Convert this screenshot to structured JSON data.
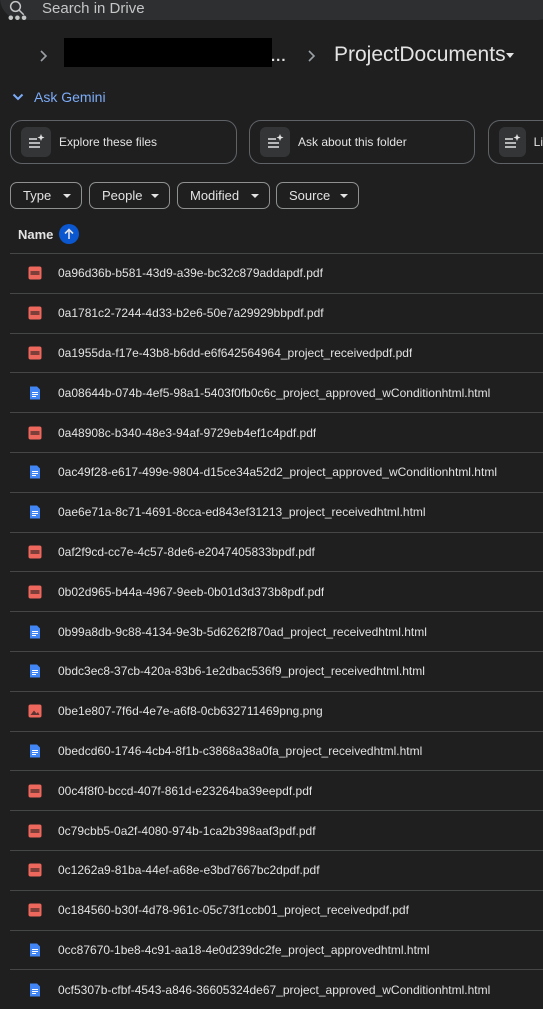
{
  "search": {
    "placeholder": "Search in Drive"
  },
  "breadcrumb": {
    "more": "•••",
    "ellipsis": "...",
    "current": "ProjectDocuments"
  },
  "gemini": {
    "label": "Ask Gemini"
  },
  "suggestions": [
    {
      "label": "Explore these files"
    },
    {
      "label": "Ask about this folder"
    },
    {
      "label": "Li"
    }
  ],
  "filters": [
    "Type",
    "People",
    "Modified",
    "Source"
  ],
  "table": {
    "name_header": "Name"
  },
  "files": [
    {
      "name": "0a96d36b-b581-43d9-a39e-bc32c879addapdf.pdf",
      "kind": "pdf"
    },
    {
      "name": "0a1781c2-7244-4d33-b2e6-50e7a29929bbpdf.pdf",
      "kind": "pdf"
    },
    {
      "name": "0a1955da-f17e-43b8-b6dd-e6f642564964_project_receivedpdf.pdf",
      "kind": "pdf"
    },
    {
      "name": "0a08644b-074b-4ef5-98a1-5403f0fb0c6c_project_approved_wConditionhtml.html",
      "kind": "doc"
    },
    {
      "name": "0a48908c-b340-48e3-94af-9729eb4ef1c4pdf.pdf",
      "kind": "pdf"
    },
    {
      "name": "0ac49f28-e617-499e-9804-d15ce34a52d2_project_approved_wConditionhtml.html",
      "kind": "doc"
    },
    {
      "name": "0ae6e71a-8c71-4691-8cca-ed843ef31213_project_receivedhtml.html",
      "kind": "doc"
    },
    {
      "name": "0af2f9cd-cc7e-4c57-8de6-e2047405833bpdf.pdf",
      "kind": "pdf"
    },
    {
      "name": "0b02d965-b44a-4967-9eeb-0b01d3d373b8pdf.pdf",
      "kind": "pdf"
    },
    {
      "name": "0b99a8db-9c88-4134-9e3b-5d6262f870ad_project_receivedhtml.html",
      "kind": "doc"
    },
    {
      "name": "0bdc3ec8-37cb-420a-83b6-1e2dbac536f9_project_receivedhtml.html",
      "kind": "doc"
    },
    {
      "name": "0be1e807-7f6d-4e7e-a6f8-0cb632711469png.png",
      "kind": "image"
    },
    {
      "name": "0bedcd60-1746-4cb4-8f1b-c3868a38a0fa_project_receivedhtml.html",
      "kind": "doc"
    },
    {
      "name": "00c4f8f0-bccd-407f-861d-e23264ba39eepdf.pdf",
      "kind": "pdf"
    },
    {
      "name": "0c79cbb5-0a2f-4080-974b-1ca2b398aaf3pdf.pdf",
      "kind": "pdf"
    },
    {
      "name": "0c1262a9-81ba-44ef-a68e-e3bd7667bc2dpdf.pdf",
      "kind": "pdf"
    },
    {
      "name": "0c184560-b30f-4d78-961c-05c73f1ccb01_project_receivedpdf.pdf",
      "kind": "pdf"
    },
    {
      "name": "0cc87670-1be8-4c91-aa18-4e0d239dc2fe_project_approvedhtml.html",
      "kind": "doc"
    },
    {
      "name": "0cf5307b-cfbf-4543-a846-36605324de67_project_approved_wConditionhtml.html",
      "kind": "doc"
    }
  ],
  "colors": {
    "pdf": "#ee675c",
    "doc": "#4285f4",
    "image": "#ee675c",
    "accent": "#7cacf8",
    "sort": "#0b57d0"
  }
}
